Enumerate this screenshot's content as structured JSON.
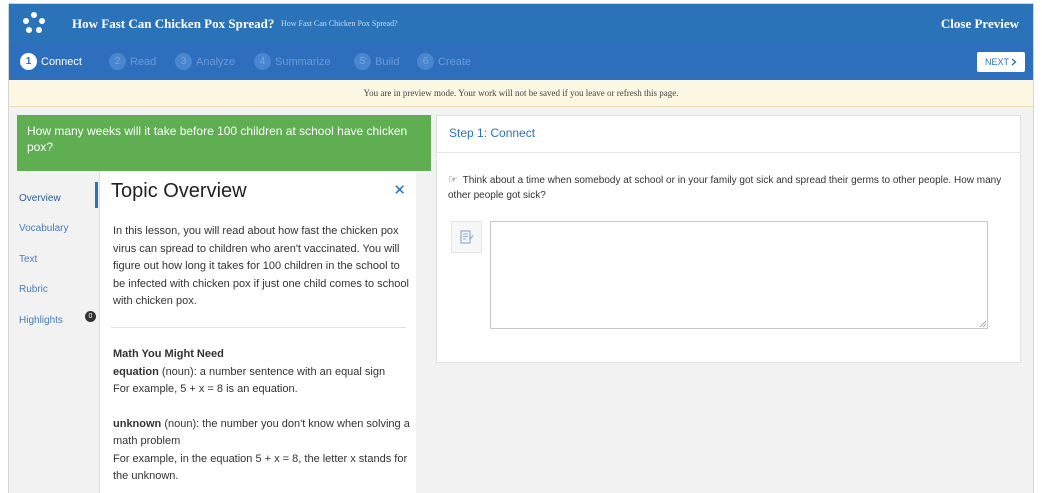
{
  "header": {
    "title": "How Fast Can Chicken Pox Spread?",
    "subtitle": "How Fast Can Chicken Pox Spread?",
    "close_label": "Close Preview"
  },
  "steps": [
    {
      "num": "1",
      "label": "Connect",
      "active": true
    },
    {
      "num": "2",
      "label": "Read",
      "active": false
    },
    {
      "num": "3",
      "label": "Analyze",
      "active": false
    },
    {
      "num": "4",
      "label": "Summarize",
      "active": false
    },
    {
      "num": "5",
      "label": "Build",
      "active": false
    },
    {
      "num": "6",
      "label": "Create",
      "active": false
    }
  ],
  "next_label": "NEXT",
  "next_icon": "chevron-right-icon",
  "notice": "You are in preview mode. Your work will not be saved if you leave or refresh this page.",
  "question": "How many weeks will it take before 100 children at school have chicken pox?",
  "sidebar": {
    "tabs": [
      "Overview",
      "Vocabulary",
      "Text",
      "Rubric",
      "Highlights"
    ],
    "highlights_count": "0"
  },
  "overview": {
    "title": "Topic Overview",
    "close_icon": "close-icon",
    "intro": "In this lesson, you will read about how fast the chicken pox virus can spread to children who aren't vaccinated. You will figure out how long it takes for 100 children in the school to be infected with chicken pox if just one child comes to school with chicken pox.",
    "math_heading": "Math You Might Need",
    "equation_term": "equation",
    "equation_def": " (noun): a number sentence with an equal sign",
    "equation_example": "For example, 5 + x = 8 is an equation.",
    "unknown_term": "unknown",
    "unknown_def": " (noun): the number you don't know when solving a math problem",
    "unknown_example": "For example, in the equation 5 + x = 8, the letter x stands for the unknown."
  },
  "step_panel": {
    "header": "Step 1: Connect",
    "prompt": "Think about a time when somebody at school or in your family got sick and spread their germs to other people. How many other people got sick?",
    "prompt_icon": "pointing-hand-icon",
    "note_icon": "note-icon",
    "answer_value": ""
  },
  "colors": {
    "topbar": "#2a73b8",
    "stepsbar": "#2d6fbd",
    "question": "#5fae52",
    "notice": "#fcf8e3"
  }
}
